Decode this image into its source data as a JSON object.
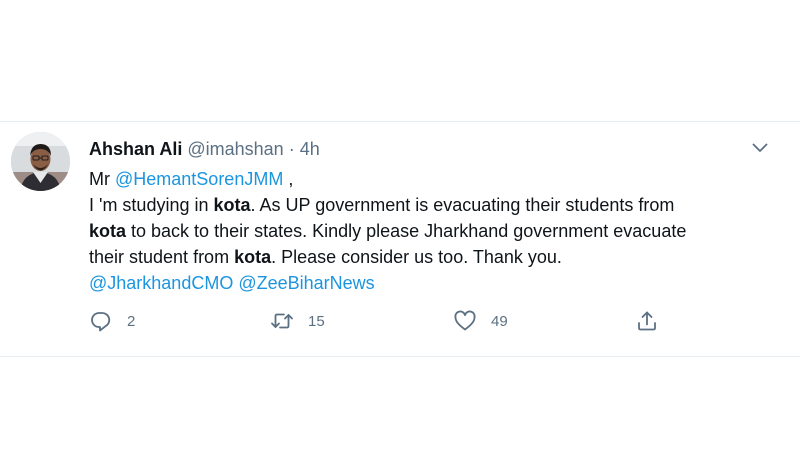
{
  "tweet": {
    "author_name": "Ahshan Ali",
    "handle": "@imahshan",
    "separator": "·",
    "time": "4h",
    "lines": [
      [
        {
          "t": "Mr "
        },
        {
          "t": "@HemantSorenJMM",
          "k": "mention"
        },
        {
          "t": " ,"
        }
      ],
      [
        {
          "t": "I 'm studying in "
        },
        {
          "t": "kota",
          "k": "bold"
        },
        {
          "t": ". As UP government is evacuating their students from"
        }
      ],
      [
        {
          "t": "kota",
          "k": "bold"
        },
        {
          "t": " to back to their states. Kindly please Jharkhand government evacuate"
        }
      ],
      [
        {
          "t": "their student from "
        },
        {
          "t": "kota",
          "k": "bold"
        },
        {
          "t": ". Please consider us too. Thank you."
        }
      ],
      [
        {
          "t": "@JharkhandCMO",
          "k": "mention"
        },
        {
          "t": " "
        },
        {
          "t": "@ZeeBiharNews",
          "k": "mention"
        }
      ]
    ],
    "actions": {
      "reply_count": "2",
      "retweet_count": "15",
      "like_count": "49"
    }
  },
  "icons": {
    "avatar": "avatar",
    "caret": "chevron-down-icon",
    "reply": "reply-icon",
    "retweet": "retweet-icon",
    "like": "heart-icon",
    "share": "share-icon"
  },
  "colors": {
    "link": "#1b95e0",
    "muted": "#5b7083",
    "text": "#0f1419",
    "divider": "#e6ecf0"
  }
}
